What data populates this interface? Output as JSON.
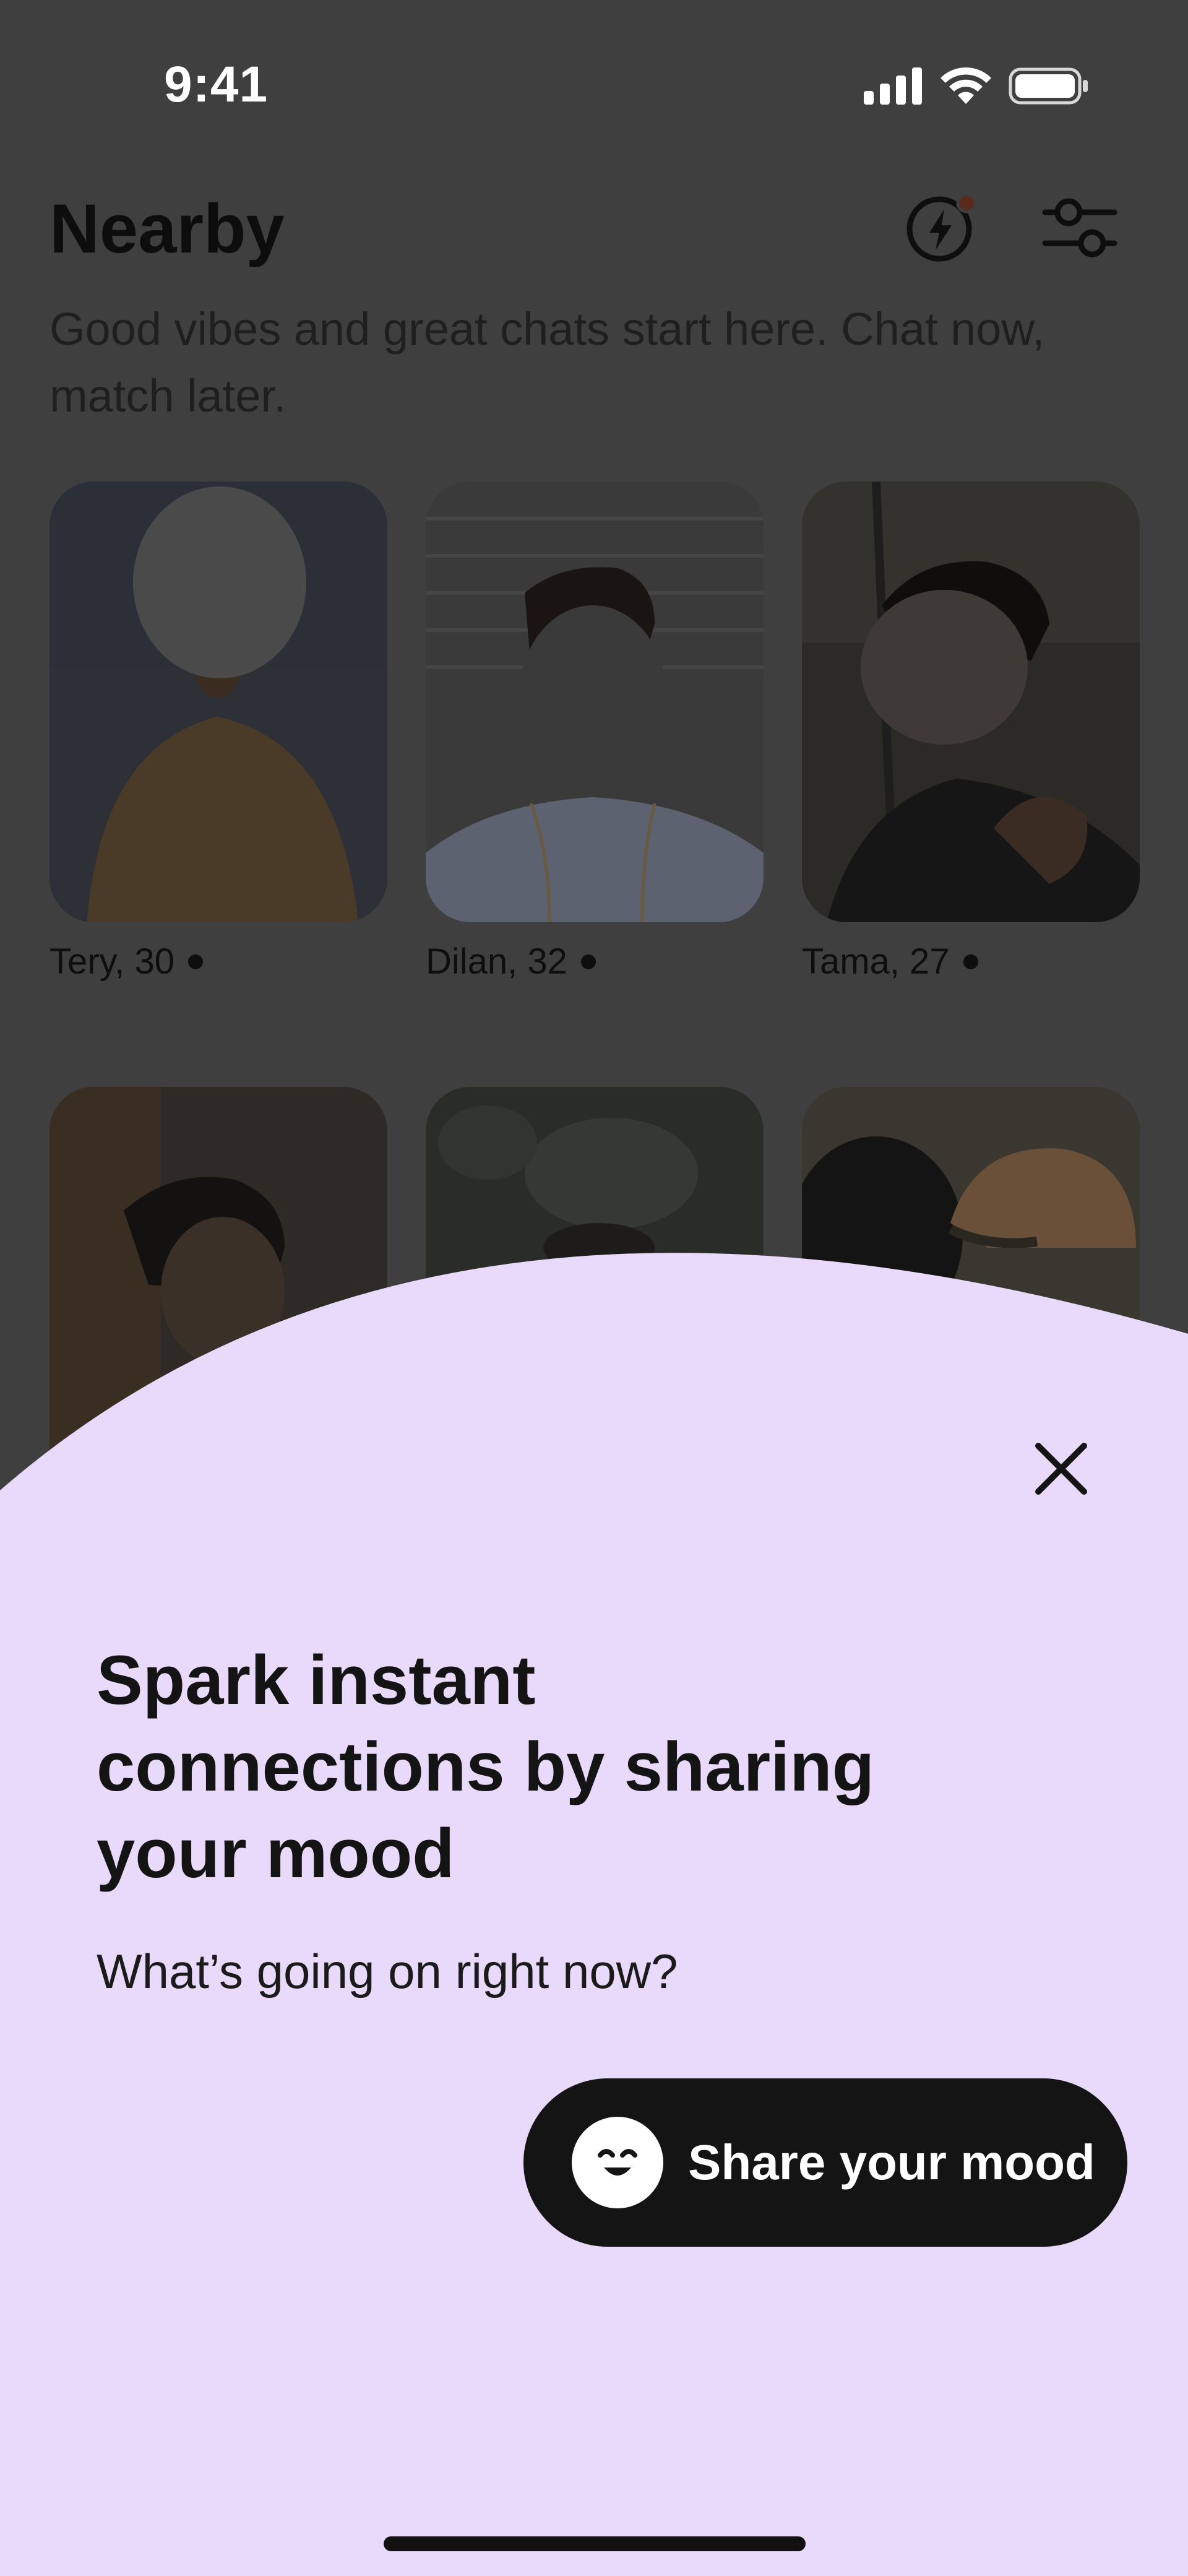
{
  "status_bar": {
    "time": "9:41"
  },
  "header": {
    "title": "Nearby",
    "subtitle": "Good vibes and great chats start here. Chat now, match later.",
    "boost_icon": "lightning-icon",
    "filter_icon": "sliders-icon"
  },
  "profiles": [
    {
      "label": "Tery, 30",
      "online": true
    },
    {
      "label": "Dilan, 32",
      "online": true
    },
    {
      "label": "Tama, 27",
      "online": true
    },
    {
      "label": "",
      "online": false
    },
    {
      "label": "",
      "online": false
    },
    {
      "label": "",
      "online": false
    }
  ],
  "sheet": {
    "title": "Spark instant connections by sharing your mood",
    "subtitle": "What’s going on right now?",
    "cta_label": "Share your mood",
    "close_icon": "close-icon",
    "background": "#e9dafc"
  },
  "colors": {
    "overlay_bg": "#3f3f3f",
    "button_bg": "#141414",
    "online_dot": "#0e0e0e"
  }
}
